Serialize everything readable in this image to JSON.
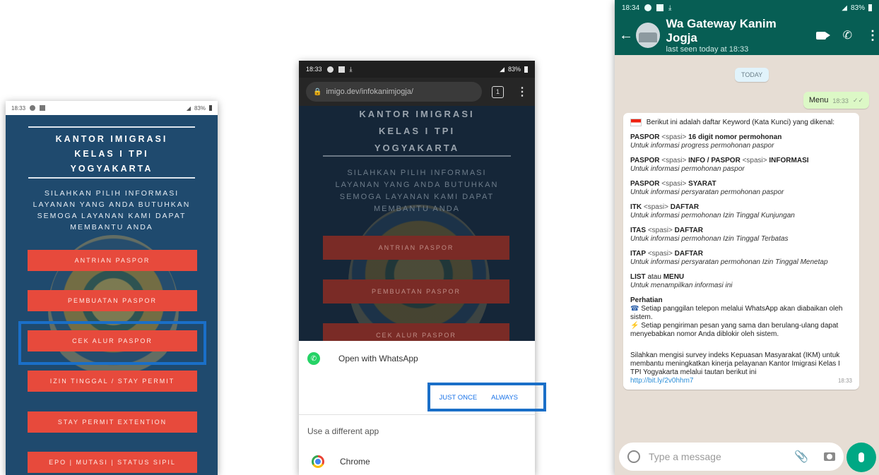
{
  "phone1": {
    "status": {
      "time": "18:33",
      "battery": "83%"
    },
    "office_title_lines": [
      "KANTOR IMIGRASI",
      "KELAS I TPI",
      "YOGYAKARTA"
    ],
    "subtitle_lines": [
      "SILAHKAN PILIH INFORMASI",
      "LAYANAN YANG ANDA BUTUHKAN",
      "SEMOGA LAYANAN KAMI DAPAT",
      "MEMBANTU ANDA"
    ],
    "menu_buttons": [
      "ANTRIAN PASPOR",
      "PEMBUATAN PASPOR",
      "CEK ALUR PASPOR",
      "IZIN TINGGAL / STAY PERMIT",
      "STAY PERMIT EXTENTION",
      "EPO | MUTASI | STATUS SIPIL"
    ],
    "highlight_color": "#1a6fc8"
  },
  "phone2": {
    "status": {
      "time": "18:33",
      "battery": "83%"
    },
    "url": "imigo.dev/infokanimjogja/",
    "tab_count": "1",
    "office_title_lines": [
      "KANTOR IMIGRASI",
      "KELAS I TPI",
      "YOGYAKARTA"
    ],
    "subtitle_lines": [
      "SILAHKAN PILIH INFORMASI",
      "LAYANAN YANG ANDA BUTUHKAN",
      "SEMOGA LAYANAN KAMI DAPAT",
      "MEMBANTU ANDA"
    ],
    "menu_buttons": [
      "ANTRIAN PASPOR",
      "PEMBUATAN PASPOR",
      "CEK ALUR PASPOR"
    ],
    "sheet": {
      "open_with": "Open with WhatsApp",
      "just_once": "JUST ONCE",
      "always": "ALWAYS",
      "different_app": "Use a different app",
      "chrome": "Chrome"
    }
  },
  "phone3": {
    "status": {
      "time": "18:34",
      "battery": "83%"
    },
    "contact_name": "Wa Gateway Kanim Jogja",
    "last_seen": "last seen today at 18:33",
    "date_chip": "TODAY",
    "outgoing": {
      "text": "Menu",
      "time": "18:33"
    },
    "incoming": {
      "intro": "Berikut ini adalah daftar Keyword (Kata Kunci) yang dikenal:",
      "keywords": [
        {
          "k1": "PASPOR",
          "sep1": " <spasi> ",
          "k2": "16 digit nomor permohonan",
          "desc": "Untuk informasi progress permohonan paspor"
        },
        {
          "k1": "PASPOR",
          "sep1": " <spasi> ",
          "k2": "INFO / PASPOR",
          "sep2": " <spasi> ",
          "k3": "INFORMASI",
          "desc": "Untuk informasi permohonan paspor"
        },
        {
          "k1": "PASPOR",
          "sep1": " <spasi> ",
          "k2": "SYARAT",
          "desc": "Untuk informasi persyaratan permohonan paspor"
        },
        {
          "k1": "ITK",
          "sep1": " <spasi> ",
          "k2": "DAFTAR",
          "desc": "Untuk informasi permohonan Izin Tinggal Kunjungan"
        },
        {
          "k1": "ITAS",
          "sep1": " <spasi> ",
          "k2": "DAFTAR",
          "desc": "Untuk informasi permohonan Izin Tinggal Terbatas"
        },
        {
          "k1": "ITAP",
          "sep1": " <spasi> ",
          "k2": "DAFTAR",
          "desc": "Untuk informasi persyaratan permohonan Izin Tinggal Menetap"
        },
        {
          "k1": "LIST",
          "sep1": " atau ",
          "k2": "MENU",
          "desc": "Untuk menampilkan informasi ini"
        }
      ],
      "attention_title": "Perhatian",
      "attention_1": "Setiap panggilan telepon melalui WhatsApp akan diabaikan oleh sistem.",
      "attention_2": "Setiap pengiriman pesan yang sama dan berulang-ulang dapat menyebabkan nomor Anda diblokir oleh sistem.",
      "survey": "Silahkan mengisi survey indeks Kepuasan Masyarakat (IKM) untuk membantu meningkatkan kinerja pelayanan Kantor Imigrasi Kelas I TPI Yogyakarta melalui tautan berikut ini",
      "link": "http://bit.ly/2v0hhm7",
      "time": "18:33"
    },
    "input_placeholder": "Type a message"
  }
}
